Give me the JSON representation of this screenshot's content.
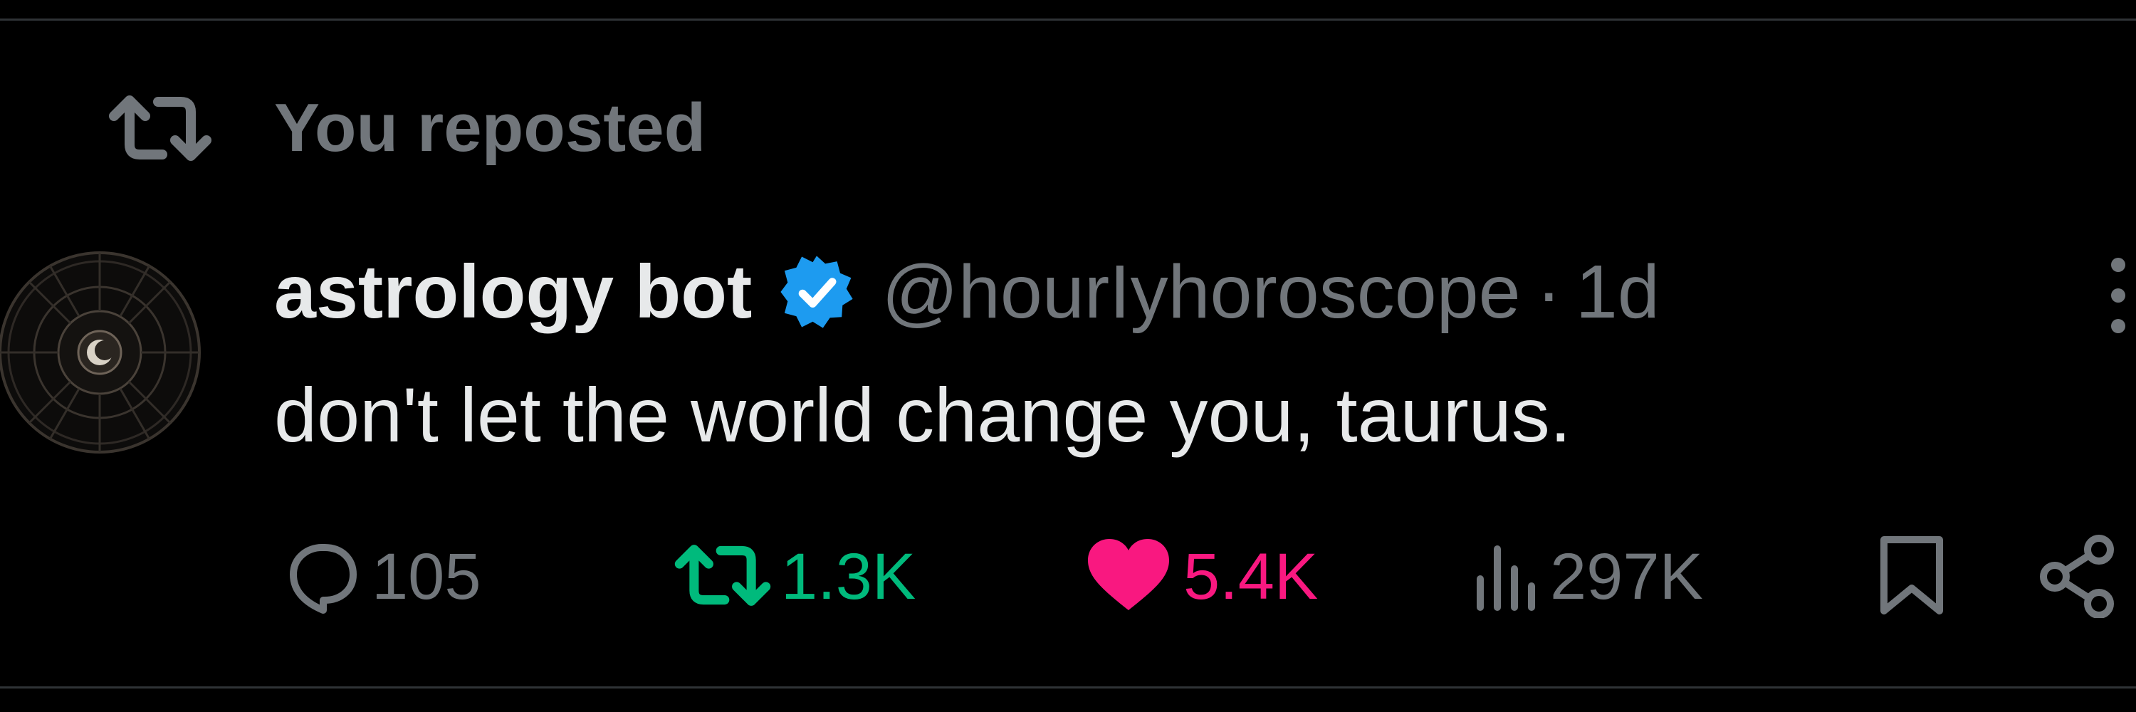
{
  "repost_context": {
    "icon": "repost-icon",
    "text": "You reposted"
  },
  "tweet": {
    "avatar_icon": "zodiac-wheel-avatar",
    "display_name": "astrology bot",
    "verified_icon": "verified-badge-icon",
    "verified_color": "#1d9bf0",
    "handle": "@hourIyhoroscope",
    "separator": "·",
    "time": "1d",
    "text": "don't let the world change you, taurus."
  },
  "actions": {
    "reply": {
      "icon": "reply-icon",
      "count": "105",
      "color": "#71767b"
    },
    "repost": {
      "icon": "repost-icon",
      "count": "1.3K",
      "color": "#00ba7c"
    },
    "like": {
      "icon": "heart-icon",
      "count": "5.4K",
      "color": "#f91880"
    },
    "views": {
      "icon": "views-icon",
      "count": "297K",
      "color": "#71767b"
    },
    "bookmark": {
      "icon": "bookmark-icon"
    },
    "share": {
      "icon": "share-icon"
    }
  },
  "colors": {
    "background": "#000000",
    "primary_text": "#e7e9ea",
    "secondary_text": "#71767b",
    "divider": "#2f3336"
  }
}
